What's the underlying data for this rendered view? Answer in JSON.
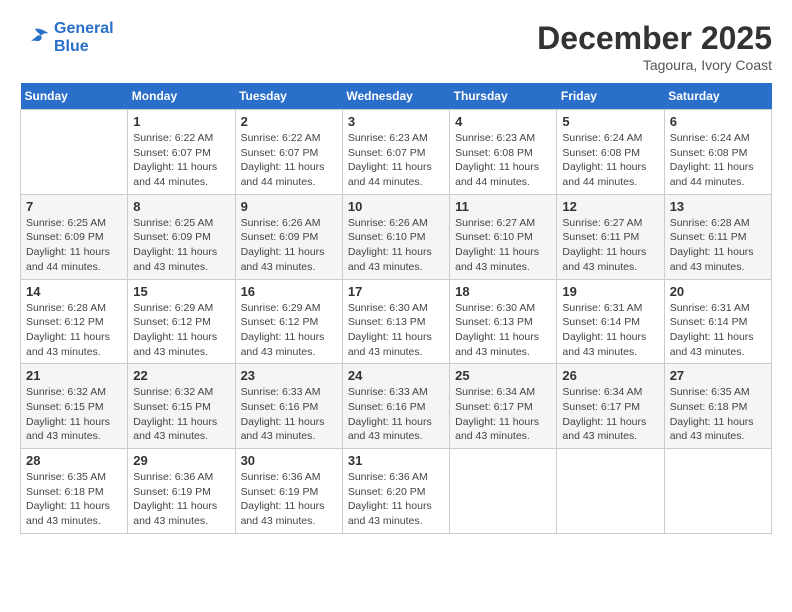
{
  "header": {
    "logo_line1": "General",
    "logo_line2": "Blue",
    "month": "December 2025",
    "location": "Tagoura, Ivory Coast"
  },
  "days_of_week": [
    "Sunday",
    "Monday",
    "Tuesday",
    "Wednesday",
    "Thursday",
    "Friday",
    "Saturday"
  ],
  "weeks": [
    [
      {
        "day": "",
        "info": ""
      },
      {
        "day": "1",
        "info": "Sunrise: 6:22 AM\nSunset: 6:07 PM\nDaylight: 11 hours and 44 minutes."
      },
      {
        "day": "2",
        "info": "Sunrise: 6:22 AM\nSunset: 6:07 PM\nDaylight: 11 hours and 44 minutes."
      },
      {
        "day": "3",
        "info": "Sunrise: 6:23 AM\nSunset: 6:07 PM\nDaylight: 11 hours and 44 minutes."
      },
      {
        "day": "4",
        "info": "Sunrise: 6:23 AM\nSunset: 6:08 PM\nDaylight: 11 hours and 44 minutes."
      },
      {
        "day": "5",
        "info": "Sunrise: 6:24 AM\nSunset: 6:08 PM\nDaylight: 11 hours and 44 minutes."
      },
      {
        "day": "6",
        "info": "Sunrise: 6:24 AM\nSunset: 6:08 PM\nDaylight: 11 hours and 44 minutes."
      }
    ],
    [
      {
        "day": "7",
        "info": "Sunrise: 6:25 AM\nSunset: 6:09 PM\nDaylight: 11 hours and 44 minutes."
      },
      {
        "day": "8",
        "info": "Sunrise: 6:25 AM\nSunset: 6:09 PM\nDaylight: 11 hours and 43 minutes."
      },
      {
        "day": "9",
        "info": "Sunrise: 6:26 AM\nSunset: 6:09 PM\nDaylight: 11 hours and 43 minutes."
      },
      {
        "day": "10",
        "info": "Sunrise: 6:26 AM\nSunset: 6:10 PM\nDaylight: 11 hours and 43 minutes."
      },
      {
        "day": "11",
        "info": "Sunrise: 6:27 AM\nSunset: 6:10 PM\nDaylight: 11 hours and 43 minutes."
      },
      {
        "day": "12",
        "info": "Sunrise: 6:27 AM\nSunset: 6:11 PM\nDaylight: 11 hours and 43 minutes."
      },
      {
        "day": "13",
        "info": "Sunrise: 6:28 AM\nSunset: 6:11 PM\nDaylight: 11 hours and 43 minutes."
      }
    ],
    [
      {
        "day": "14",
        "info": "Sunrise: 6:28 AM\nSunset: 6:12 PM\nDaylight: 11 hours and 43 minutes."
      },
      {
        "day": "15",
        "info": "Sunrise: 6:29 AM\nSunset: 6:12 PM\nDaylight: 11 hours and 43 minutes."
      },
      {
        "day": "16",
        "info": "Sunrise: 6:29 AM\nSunset: 6:12 PM\nDaylight: 11 hours and 43 minutes."
      },
      {
        "day": "17",
        "info": "Sunrise: 6:30 AM\nSunset: 6:13 PM\nDaylight: 11 hours and 43 minutes."
      },
      {
        "day": "18",
        "info": "Sunrise: 6:30 AM\nSunset: 6:13 PM\nDaylight: 11 hours and 43 minutes."
      },
      {
        "day": "19",
        "info": "Sunrise: 6:31 AM\nSunset: 6:14 PM\nDaylight: 11 hours and 43 minutes."
      },
      {
        "day": "20",
        "info": "Sunrise: 6:31 AM\nSunset: 6:14 PM\nDaylight: 11 hours and 43 minutes."
      }
    ],
    [
      {
        "day": "21",
        "info": "Sunrise: 6:32 AM\nSunset: 6:15 PM\nDaylight: 11 hours and 43 minutes."
      },
      {
        "day": "22",
        "info": "Sunrise: 6:32 AM\nSunset: 6:15 PM\nDaylight: 11 hours and 43 minutes."
      },
      {
        "day": "23",
        "info": "Sunrise: 6:33 AM\nSunset: 6:16 PM\nDaylight: 11 hours and 43 minutes."
      },
      {
        "day": "24",
        "info": "Sunrise: 6:33 AM\nSunset: 6:16 PM\nDaylight: 11 hours and 43 minutes."
      },
      {
        "day": "25",
        "info": "Sunrise: 6:34 AM\nSunset: 6:17 PM\nDaylight: 11 hours and 43 minutes."
      },
      {
        "day": "26",
        "info": "Sunrise: 6:34 AM\nSunset: 6:17 PM\nDaylight: 11 hours and 43 minutes."
      },
      {
        "day": "27",
        "info": "Sunrise: 6:35 AM\nSunset: 6:18 PM\nDaylight: 11 hours and 43 minutes."
      }
    ],
    [
      {
        "day": "28",
        "info": "Sunrise: 6:35 AM\nSunset: 6:18 PM\nDaylight: 11 hours and 43 minutes."
      },
      {
        "day": "29",
        "info": "Sunrise: 6:36 AM\nSunset: 6:19 PM\nDaylight: 11 hours and 43 minutes."
      },
      {
        "day": "30",
        "info": "Sunrise: 6:36 AM\nSunset: 6:19 PM\nDaylight: 11 hours and 43 minutes."
      },
      {
        "day": "31",
        "info": "Sunrise: 6:36 AM\nSunset: 6:20 PM\nDaylight: 11 hours and 43 minutes."
      },
      {
        "day": "",
        "info": ""
      },
      {
        "day": "",
        "info": ""
      },
      {
        "day": "",
        "info": ""
      }
    ]
  ]
}
